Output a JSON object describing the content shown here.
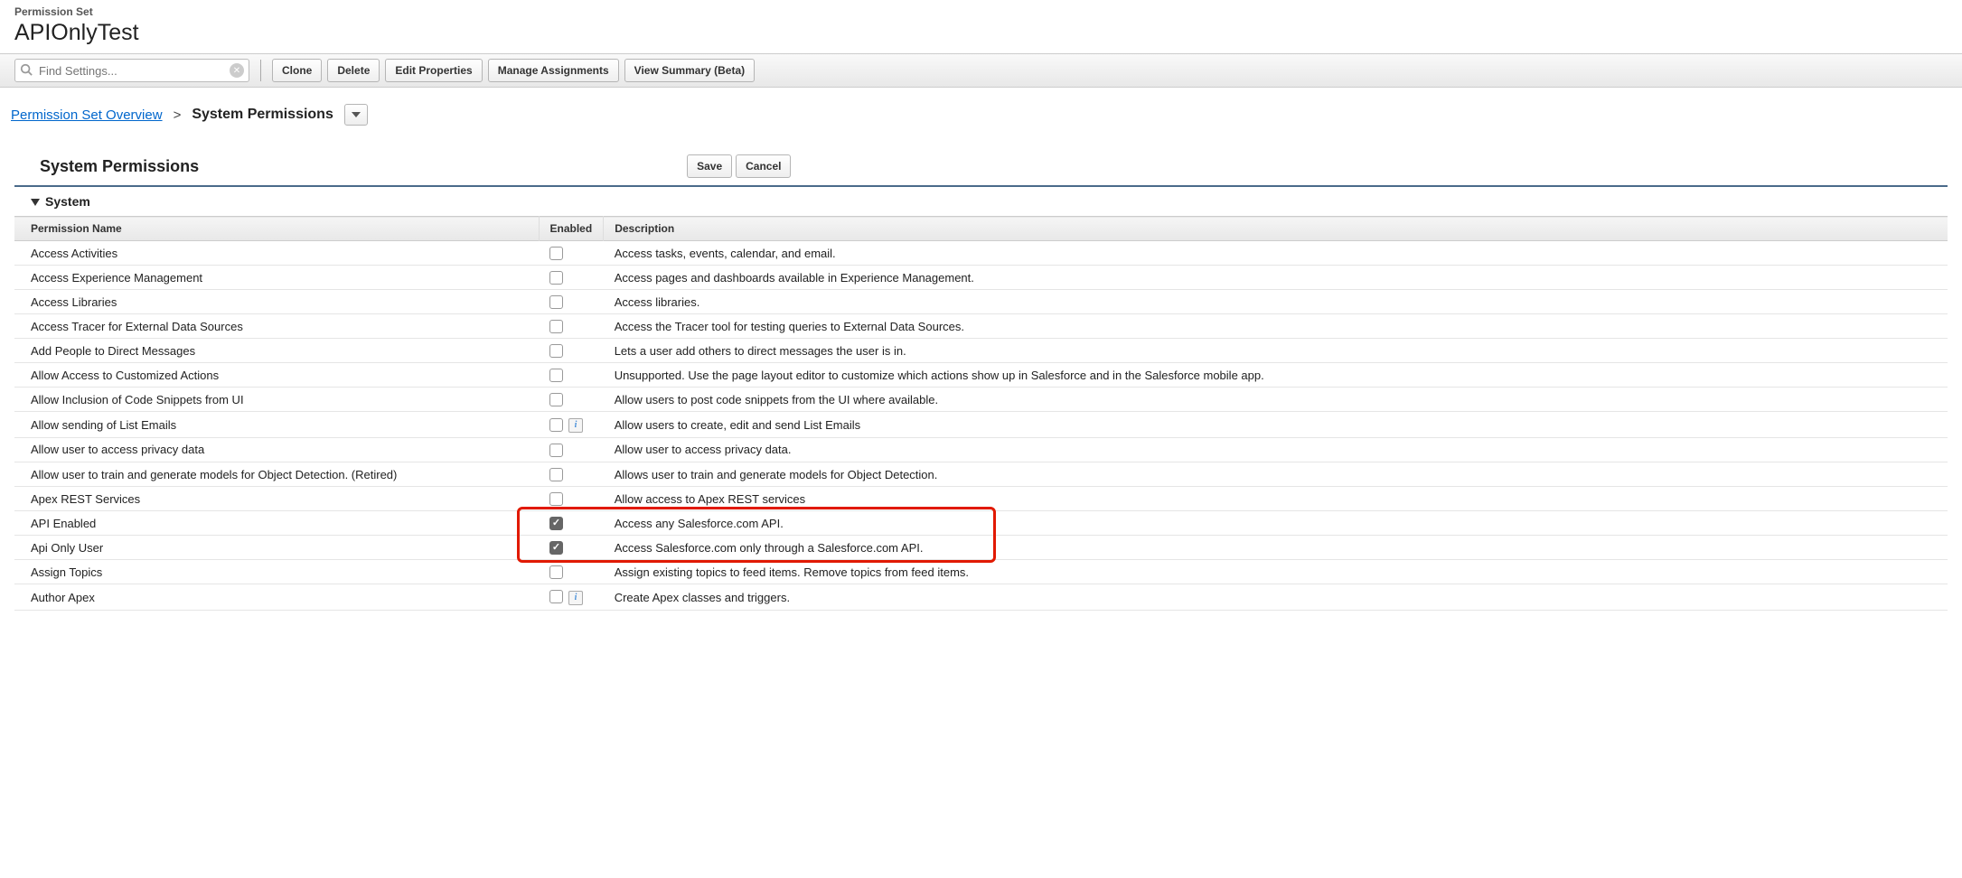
{
  "header": {
    "label": "Permission Set",
    "title": "APIOnlyTest"
  },
  "search": {
    "placeholder": "Find Settings..."
  },
  "toolbar": {
    "clone": "Clone",
    "delete": "Delete",
    "edit_properties": "Edit Properties",
    "manage_assignments": "Manage Assignments",
    "view_summary": "View Summary (Beta)"
  },
  "breadcrumb": {
    "overview": "Permission Set Overview",
    "sep": ">",
    "current": "System Permissions"
  },
  "section": {
    "title": "System Permissions",
    "save": "Save",
    "cancel": "Cancel",
    "group": "System"
  },
  "table": {
    "headers": {
      "name": "Permission Name",
      "enabled": "Enabled",
      "description": "Description"
    },
    "rows": [
      {
        "name": "Access Activities",
        "enabled": false,
        "info": false,
        "description": "Access tasks, events, calendar, and email."
      },
      {
        "name": "Access Experience Management",
        "enabled": false,
        "info": false,
        "description": "Access pages and dashboards available in Experience Management."
      },
      {
        "name": "Access Libraries",
        "enabled": false,
        "info": false,
        "description": "Access libraries."
      },
      {
        "name": "Access Tracer for External Data Sources",
        "enabled": false,
        "info": false,
        "description": "Access the Tracer tool for testing queries to External Data Sources."
      },
      {
        "name": "Add People to Direct Messages",
        "enabled": false,
        "info": false,
        "description": "Lets a user add others to direct messages the user is in."
      },
      {
        "name": "Allow Access to Customized Actions",
        "enabled": false,
        "info": false,
        "description": "Unsupported. Use the page layout editor to customize which actions show up in Salesforce and in the Salesforce mobile app."
      },
      {
        "name": "Allow Inclusion of Code Snippets from UI",
        "enabled": false,
        "info": false,
        "description": "Allow users to post code snippets from the UI where available."
      },
      {
        "name": "Allow sending of List Emails",
        "enabled": false,
        "info": true,
        "description": "Allow users to create, edit and send List Emails"
      },
      {
        "name": "Allow user to access privacy data",
        "enabled": false,
        "info": false,
        "description": "Allow user to access privacy data."
      },
      {
        "name": "Allow user to train and generate models for Object Detection. (Retired)",
        "enabled": false,
        "info": false,
        "description": "Allows user to train and generate models for Object Detection."
      },
      {
        "name": "Apex REST Services",
        "enabled": false,
        "info": false,
        "description": "Allow access to Apex REST services"
      },
      {
        "name": "API Enabled",
        "enabled": true,
        "info": false,
        "description": "Access any Salesforce.com API."
      },
      {
        "name": "Api Only User",
        "enabled": true,
        "info": false,
        "description": "Access Salesforce.com only through a Salesforce.com API."
      },
      {
        "name": "Assign Topics",
        "enabled": false,
        "info": false,
        "description": "Assign existing topics to feed items. Remove topics from feed items."
      },
      {
        "name": "Author Apex",
        "enabled": false,
        "info": true,
        "description": "Create Apex classes and triggers."
      }
    ]
  }
}
